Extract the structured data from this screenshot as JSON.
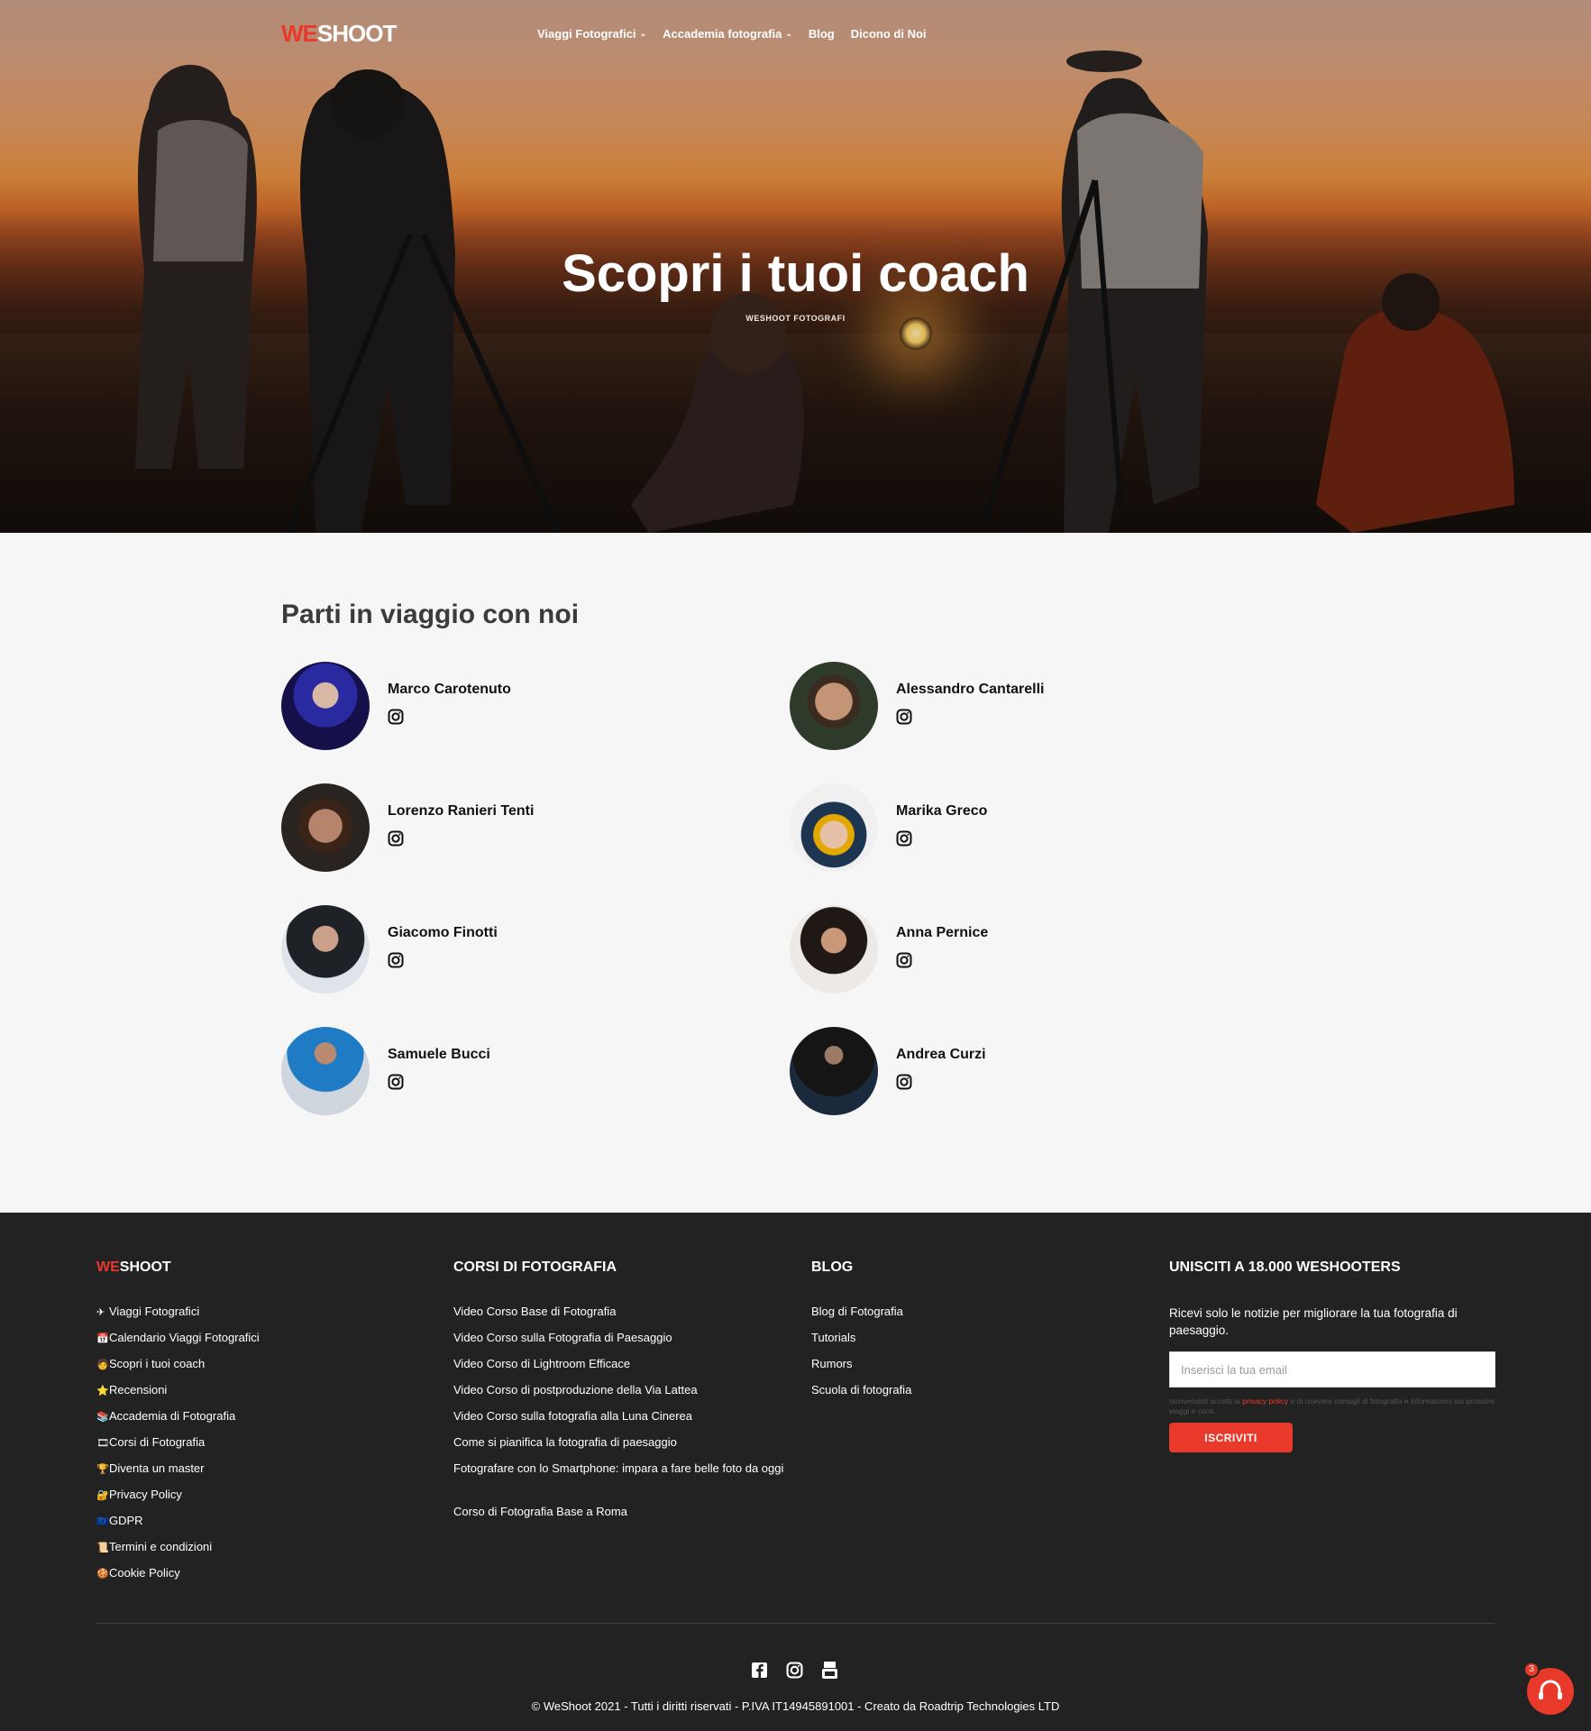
{
  "header": {
    "logo_we": "WE",
    "logo_shoot": "SHOOT",
    "menu": [
      {
        "label": "Viaggi Fotografici",
        "chevron": "chevron-down-icon"
      },
      {
        "label": "Accademia fotografia",
        "chevron": "chevron-down-icon"
      },
      {
        "label": "Blog"
      },
      {
        "label": "Dicono di Noi"
      }
    ]
  },
  "hero": {
    "title": "Scopri i tuoi coach",
    "subtitle": "WESHOOT FOTOGRAFI"
  },
  "coaches": {
    "title": "Parti in viaggio con noi",
    "items": [
      {
        "name": "Marco Carotenuto"
      },
      {
        "name": "Alessandro Cantarelli"
      },
      {
        "name": "Lorenzo Ranieri Tenti"
      },
      {
        "name": "Marika Greco"
      },
      {
        "name": "Giacomo Finotti"
      },
      {
        "name": "Anna Pernice"
      },
      {
        "name": "Samuele Bucci"
      },
      {
        "name": "Andrea Curzi"
      }
    ]
  },
  "footer": {
    "col1": {
      "title_we": "WE",
      "title_shoot": "SHOOT",
      "links": [
        {
          "emoji": "✈",
          "label": "Viaggi Fotografici"
        },
        {
          "emoji": "📅",
          "label": "Calendario Viaggi Fotografici"
        },
        {
          "emoji": "🧑",
          "label": "Scopri i tuoi coach"
        },
        {
          "emoji": "⭐",
          "label": "Recensioni"
        },
        {
          "emoji": "📚",
          "label": "Accademia di Fotografia"
        },
        {
          "emoji": "🎞",
          "label": "Corsi di Fotografia"
        },
        {
          "emoji": "🏆",
          "label": "Diventa un master"
        },
        {
          "emoji": "🔐",
          "label": "Privacy Policy"
        },
        {
          "emoji": "🇪🇺",
          "label": "GDPR"
        },
        {
          "emoji": "📜",
          "label": "Termini e condizioni"
        },
        {
          "emoji": "🍪",
          "label": "Cookie Policy"
        }
      ]
    },
    "col2": {
      "title": "CORSI DI FOTOGRAFIA",
      "links": [
        "Video Corso Base di Fotografia",
        "Video Corso sulla Fotografia di Paesaggio",
        "Video Corso di Lightroom Efficace",
        "Video Corso di postproduzione della Via Lattea",
        "Video Corso sulla fotografia alla Luna Cinerea",
        "Come si pianifica la fotografia di paesaggio",
        "Fotografare con lo Smartphone: impara a fare belle foto da oggi",
        "Corso di Fotografia Base a Roma"
      ]
    },
    "col3": {
      "title": "BLOG",
      "links": [
        "Blog di Fotografia",
        "Tutorials",
        "Rumors",
        "Scuola di fotografia"
      ]
    },
    "col4": {
      "title": "UNISCITI A 18.000 WESHOOTERS",
      "text": "Ricevi solo le notizie per migliorare la tua fotografia di paesaggio.",
      "email_placeholder": "Inserisci la tua email",
      "consent_before": "Iscrivendoti accetti la ",
      "consent_link": "privacy policy",
      "consent_after": " e di ricevere consigli di fotografia e informazioni sui prossimi viaggi e corsi.",
      "button": "ISCRIVITI"
    },
    "social": [
      "facebook-icon",
      "instagram-icon",
      "youtube-icon"
    ],
    "copyright": "© WeShoot 2021 - Tutti i diritti riservati - P.IVA IT14945891001 - Creato da Roadtrip Technologies LTD",
    "chat_badge": "3"
  }
}
